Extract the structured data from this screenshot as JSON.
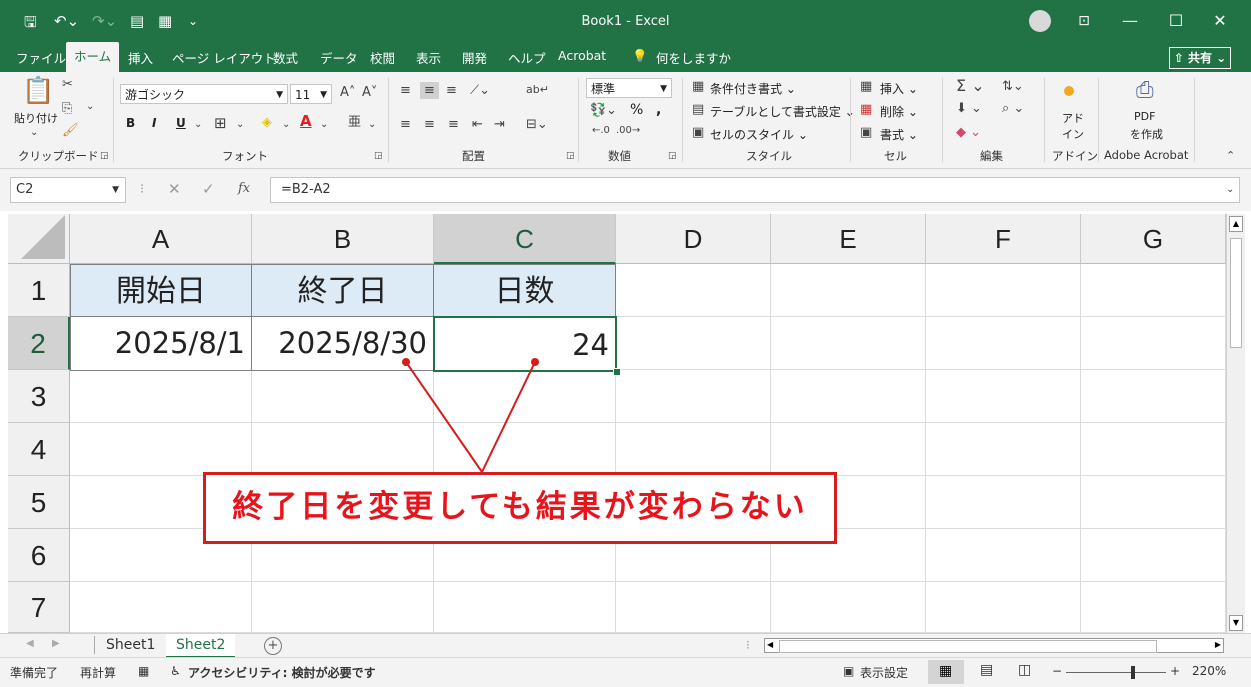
{
  "window": {
    "title": "Book1  -  Excel",
    "minimize": "—",
    "maximize": "☐",
    "close": "✕"
  },
  "ribbon_tabs": [
    "ファイル",
    "ホーム",
    "挿入",
    "ページ レイアウト",
    "数式",
    "データ",
    "校閲",
    "表示",
    "開発",
    "ヘルプ",
    "Acrobat"
  ],
  "tell_me": "何をしますか",
  "share_label": "共有",
  "clipboard": {
    "paste_label": "貼り付け",
    "group_label": "クリップボード"
  },
  "font": {
    "name": "游ゴシック",
    "size": "11",
    "group_label": "フォント",
    "bold": "B",
    "italic": "I",
    "underline": "U"
  },
  "alignment": {
    "group_label": "配置"
  },
  "number": {
    "format": "標準",
    "percent": "%",
    "comma": ",",
    "group_label": "数値"
  },
  "styles": {
    "conditional": "条件付き書式",
    "table": "テーブルとして書式設定",
    "cell_styles": "セルのスタイル",
    "group_label": "スタイル"
  },
  "cells": {
    "insert": "挿入",
    "delete": "削除",
    "format": "書式",
    "group_label": "セル"
  },
  "editing": {
    "group_label": "編集"
  },
  "addins": {
    "label_line1": "アド",
    "label_line2": "イン",
    "group_label": "アドイン"
  },
  "acrobat": {
    "label_line1": "PDF",
    "label_line2": "を作成",
    "group_label": "Adobe Acrobat"
  },
  "formula_bar": {
    "name_box": "C2",
    "formula": "=B2-A2",
    "fx": "fx"
  },
  "columns": [
    "A",
    "B",
    "C",
    "D",
    "E",
    "F",
    "G"
  ],
  "rows": [
    "1",
    "2",
    "3",
    "4",
    "5",
    "6",
    "7"
  ],
  "sheet": {
    "A1": "開始日",
    "B1": "終了日",
    "C1": "日数",
    "A2": "2025/8/1",
    "B2": "2025/8/30",
    "C2": "24"
  },
  "sheet_tabs": [
    "Sheet1",
    "Sheet2"
  ],
  "add_sheet": "+",
  "status": {
    "ready": "準備完了",
    "recalc": "再計算",
    "accessibility": "アクセシビリティ: 検討が必要です",
    "display_settings": "表示設定",
    "zoom": "220%",
    "zoom_minus": "−",
    "zoom_plus": "+"
  },
  "callout": {
    "text": "終了日を変更しても結果が変わらない",
    "color": "#e8141c"
  },
  "colors": {
    "accent": "#217346",
    "header_fill": "#ddebf7"
  }
}
